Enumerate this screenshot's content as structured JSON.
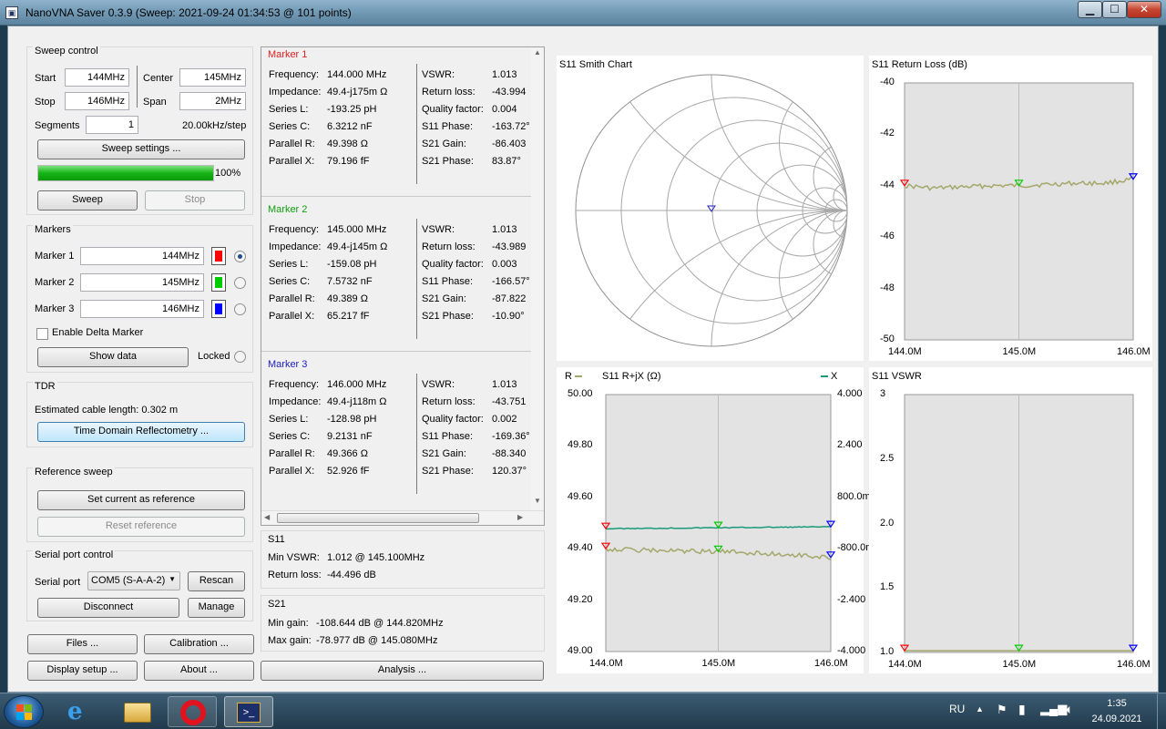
{
  "window": {
    "title": "NanoVNA Saver 0.3.9 (Sweep: 2021-09-24 01:34:53 @ 101 points)"
  },
  "sweep_control": {
    "title": "Sweep control",
    "start_label": "Start",
    "start": "144MHz",
    "center_label": "Center",
    "center": "145MHz",
    "stop_label": "Stop",
    "stop": "146MHz",
    "span_label": "Span",
    "span": "2MHz",
    "segments_label": "Segments",
    "segments": "1",
    "step": "20.00kHz/step",
    "settings_button": "Sweep settings ...",
    "progress": 1.0,
    "progress_text": "100%",
    "sweep_button": "Sweep",
    "stop_button": "Stop"
  },
  "markers": {
    "title": "Markers",
    "items": [
      {
        "label": "Marker 1",
        "value": "144MHz",
        "color": "#ff0000",
        "selected": true
      },
      {
        "label": "Marker 2",
        "value": "145MHz",
        "color": "#00cc00",
        "selected": false
      },
      {
        "label": "Marker 3",
        "value": "146MHz",
        "color": "#0000ff",
        "selected": false
      }
    ],
    "delta_label": "Enable Delta Marker",
    "show_data": "Show data",
    "locked": "Locked"
  },
  "tdr": {
    "title": "TDR",
    "cable": "Estimated cable length:  0.302 m",
    "button": "Time Domain Reflectometry ..."
  },
  "reference": {
    "title": "Reference sweep",
    "set": "Set current as reference",
    "reset": "Reset reference"
  },
  "serial": {
    "title": "Serial port control",
    "port_label": "Serial port",
    "port": "COM5 (S-A-A-2)",
    "rescan": "Rescan",
    "disconnect": "Disconnect",
    "manage": "Manage"
  },
  "buttons": {
    "files": "Files ...",
    "calibration": "Calibration ...",
    "display": "Display setup ...",
    "about": "About ...",
    "analysis": "Analysis ..."
  },
  "marker_details": [
    {
      "title": "Marker 1",
      "color": "#e02020",
      "left": [
        [
          "Frequency:",
          "144.000 MHz"
        ],
        [
          "Impedance:",
          "49.4-j175m Ω"
        ],
        [
          "Series L:",
          "-193.25 pH"
        ],
        [
          "Series C:",
          "6.3212 nF"
        ],
        [
          "Parallel R:",
          "49.398 Ω"
        ],
        [
          "Parallel X:",
          "79.196 fF"
        ]
      ],
      "right": [
        [
          "VSWR:",
          "1.013"
        ],
        [
          "Return loss:",
          "-43.994"
        ],
        [
          "Quality factor:",
          "0.004"
        ],
        [
          "S11 Phase:",
          "-163.72°"
        ],
        [
          "S21 Gain:",
          "-86.403"
        ],
        [
          "S21 Phase:",
          "83.87°"
        ]
      ]
    },
    {
      "title": "Marker 2",
      "color": "#10a010",
      "left": [
        [
          "Frequency:",
          "145.000 MHz"
        ],
        [
          "Impedance:",
          "49.4-j145m Ω"
        ],
        [
          "Series L:",
          "-159.08 pH"
        ],
        [
          "Series C:",
          "7.5732 nF"
        ],
        [
          "Parallel R:",
          "49.389 Ω"
        ],
        [
          "Parallel X:",
          "65.217 fF"
        ]
      ],
      "right": [
        [
          "VSWR:",
          "1.013"
        ],
        [
          "Return loss:",
          "-43.989"
        ],
        [
          "Quality factor:",
          "0.003"
        ],
        [
          "S11 Phase:",
          "-166.57°"
        ],
        [
          "S21 Gain:",
          "-87.822"
        ],
        [
          "S21 Phase:",
          "-10.90°"
        ]
      ]
    },
    {
      "title": "Marker 3",
      "color": "#2020c0",
      "left": [
        [
          "Frequency:",
          "146.000 MHz"
        ],
        [
          "Impedance:",
          "49.4-j118m Ω"
        ],
        [
          "Series L:",
          "-128.98 pH"
        ],
        [
          "Series C:",
          "9.2131 nF"
        ],
        [
          "Parallel R:",
          "49.366 Ω"
        ],
        [
          "Parallel X:",
          "52.926 fF"
        ]
      ],
      "right": [
        [
          "VSWR:",
          "1.013"
        ],
        [
          "Return loss:",
          "-43.751"
        ],
        [
          "Quality factor:",
          "0.002"
        ],
        [
          "S11 Phase:",
          "-169.36°"
        ],
        [
          "S21 Gain:",
          "-88.340"
        ],
        [
          "S21 Phase:",
          "120.37°"
        ]
      ]
    }
  ],
  "s11_summary": {
    "title": "S11",
    "min_vswr_label": "Min VSWR:",
    "min_vswr": "1.012 @ 145.100MHz",
    "rl_label": "Return loss:",
    "rl": "-44.496 dB"
  },
  "s21_summary": {
    "title": "S21",
    "min_gain_label": "Min gain:",
    "min_gain": "-108.644 dB @ 144.820MHz",
    "max_gain_label": "Max gain:",
    "max_gain": "-78.977 dB @ 145.080MHz"
  },
  "charts": {
    "smith": {
      "title": "S11 Smith Chart"
    },
    "return_loss": {
      "title": "S11 Return Loss (dB)",
      "y_ticks": [
        "-40",
        "-42",
        "-44",
        "-46",
        "-48",
        "-50"
      ],
      "x_ticks": [
        "144.0M",
        "145.0M",
        "146.0M"
      ]
    },
    "rjx": {
      "title": "S11 R+jX (Ω)",
      "r_legend": "R",
      "x_legend": "X",
      "y_left": [
        "50.00",
        "49.80",
        "49.60",
        "49.40",
        "49.20",
        "49.00"
      ],
      "y_right": [
        "4.000",
        "2.400",
        "800.0m",
        "-800.0m",
        "-2.400",
        "-4.000"
      ],
      "x_ticks": [
        "144.0M",
        "145.0M",
        "146.0M"
      ]
    },
    "vswr": {
      "title": "S11 VSWR",
      "y_ticks": [
        "3",
        "2.5",
        "2.0",
        "1.5",
        "1.0"
      ],
      "x_ticks": [
        "144.0M",
        "145.0M",
        "146.0M"
      ]
    }
  },
  "chart_data": [
    {
      "type": "line",
      "title": "S11 Return Loss (dB)",
      "x": [
        144.0,
        144.25,
        144.5,
        144.75,
        145.0,
        145.25,
        145.5,
        145.75,
        146.0
      ],
      "series": [
        {
          "values": [
            -44.0,
            -44.1,
            -44.05,
            -44.0,
            -44.0,
            -43.95,
            -43.9,
            -43.9,
            -43.75
          ]
        }
      ],
      "ylim": [
        -50,
        -40
      ],
      "xlim": [
        144.0,
        146.0
      ],
      "markers": [
        {
          "x": 144.0,
          "y": -44.0
        },
        {
          "x": 145.0,
          "y": -44.0
        },
        {
          "x": 146.0,
          "y": -43.75
        }
      ]
    },
    {
      "type": "line",
      "title": "S11 R+jX (Ω)",
      "x": [
        144.0,
        144.25,
        144.5,
        144.75,
        145.0,
        145.25,
        145.5,
        145.75,
        146.0
      ],
      "series": [
        {
          "name": "R",
          "values": [
            49.4,
            49.395,
            49.393,
            49.39,
            49.389,
            49.385,
            49.38,
            49.375,
            49.366
          ]
        },
        {
          "name": "X",
          "values": [
            -0.175,
            -0.168,
            -0.16,
            -0.152,
            -0.145,
            -0.138,
            -0.131,
            -0.124,
            -0.118
          ]
        }
      ],
      "ylim": [
        49.0,
        50.0
      ],
      "y2lim": [
        -4.0,
        4.0
      ],
      "xlim": [
        144.0,
        146.0
      ]
    },
    {
      "type": "line",
      "title": "S11 VSWR",
      "x": [
        144.0,
        145.0,
        146.0
      ],
      "series": [
        {
          "values": [
            1.013,
            1.013,
            1.013
          ]
        }
      ],
      "ylim": [
        1.0,
        3.0
      ],
      "xlim": [
        144.0,
        146.0
      ]
    },
    {
      "type": "scatter",
      "title": "S11 Smith Chart",
      "points": [
        {
          "re": 0.0,
          "im": 0.0
        }
      ]
    }
  ],
  "taskbar": {
    "lang": "RU",
    "time": "1:35",
    "date": "24.09.2021"
  }
}
